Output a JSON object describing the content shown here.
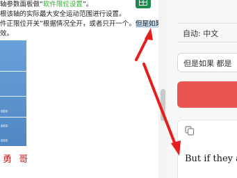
{
  "document": {
    "lines": [
      {
        "pre": "轴参数面板做“",
        "link": "软件限位设置",
        "post": "”。"
      },
      {
        "text": "根该轴的实际最大安全运动范围进行设置。"
      },
      {
        "pre": "件正限位开关”根据情况全开，或者只开一个。",
        "hl": "但是如果"
      },
      {
        "text": "效。"
      }
    ],
    "image_numbers": [
      "000",
      "000",
      "000"
    ],
    "stamp_text": "勇 哥"
  },
  "translator": {
    "language": "自动: 中文",
    "source_text": "但是如果 都是",
    "result_text": "But if they a"
  },
  "colors": {
    "accent_red": "#ec5452",
    "arrow_red": "#e51d1d",
    "link_green": "#2bb32b",
    "highlight": "#c9ddf2"
  },
  "icons": {
    "sheet": "spreadsheet-icon",
    "copy": "copy-icon"
  }
}
